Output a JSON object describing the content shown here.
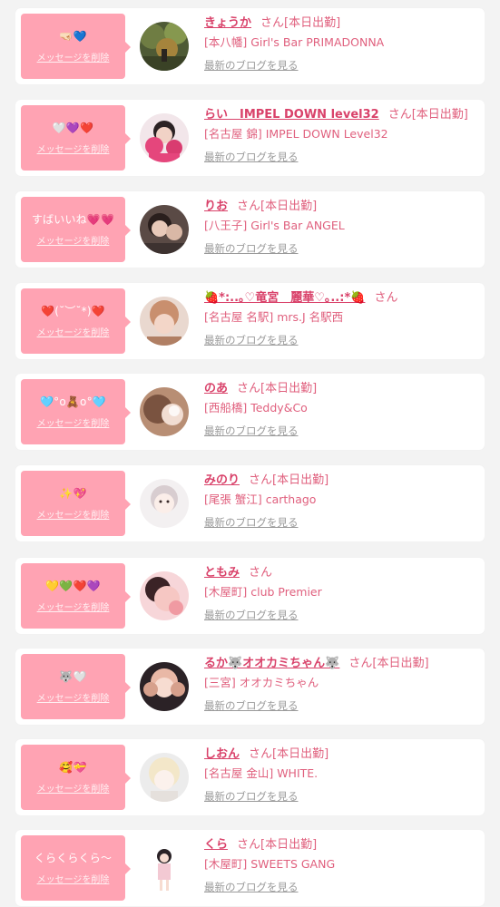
{
  "delete_label": "メッセージを削除",
  "blog_label": "最新のブログを見る",
  "colors": {
    "accent": "#ffa3b3",
    "name": "#d9426a",
    "text": "#e0607e",
    "link_gray": "#9a9a9a",
    "background": "#f3f3f3"
  },
  "items": [
    {
      "message": "🤜🏻💙",
      "name": "きょうか",
      "san": "さん[本日出勤]",
      "shop": "[本八幡] Girl's Bar PRIMADONNA",
      "avatar_icon": "avatar-photo"
    },
    {
      "message": "🤍💜❤️",
      "name": "らい　IMPEL DOWN level32",
      "san": "さん[本日出勤]",
      "shop": "[名古屋 錦] IMPEL DOWN Level32",
      "avatar_icon": "avatar-photo"
    },
    {
      "message": "すばいいね💗💗",
      "name": "りお",
      "san": "さん[本日出勤]",
      "shop": "[八王子] Girl's Bar ANGEL",
      "avatar_icon": "avatar-photo"
    },
    {
      "message": "❤️(˘︶˘*)❤️",
      "name": "🍓*:..｡♡竜宮　麗華♡｡..:*🍓",
      "san": "さん",
      "shop": "[名古屋 名駅] mrs.J 名駅西",
      "avatar_icon": "avatar-photo"
    },
    {
      "message": "🩵°o🧸o°🩵",
      "name": "のあ",
      "san": "さん[本日出勤]",
      "shop": "[西船橋] Teddy&Co",
      "avatar_icon": "avatar-photo"
    },
    {
      "message": "✨💖",
      "name": "みのり",
      "san": "さん[本日出勤]",
      "shop": "[尾張 蟹江] carthago",
      "avatar_icon": "avatar-photo"
    },
    {
      "message": "💛💚❤️💜",
      "name": "ともみ",
      "san": "さん",
      "shop": "[木屋町] club Premier",
      "avatar_icon": "avatar-photo"
    },
    {
      "message": "🐺🤍",
      "name": "るか🐺オオカミちゃん🐺",
      "san": "さん[本日出勤]",
      "shop": "[三宮] オオカミちゃん",
      "avatar_icon": "avatar-photo"
    },
    {
      "message": "🥰💝",
      "name": "しおん",
      "san": "さん[本日出勤]",
      "shop": "[名古屋 金山] WHITE.",
      "avatar_icon": "avatar-photo"
    },
    {
      "message": "くらくらくら〜",
      "name": "くら",
      "san": "さん[本日出勤]",
      "shop": "[木屋町] SWEETS GANG",
      "avatar_icon": "avatar-photo"
    }
  ]
}
